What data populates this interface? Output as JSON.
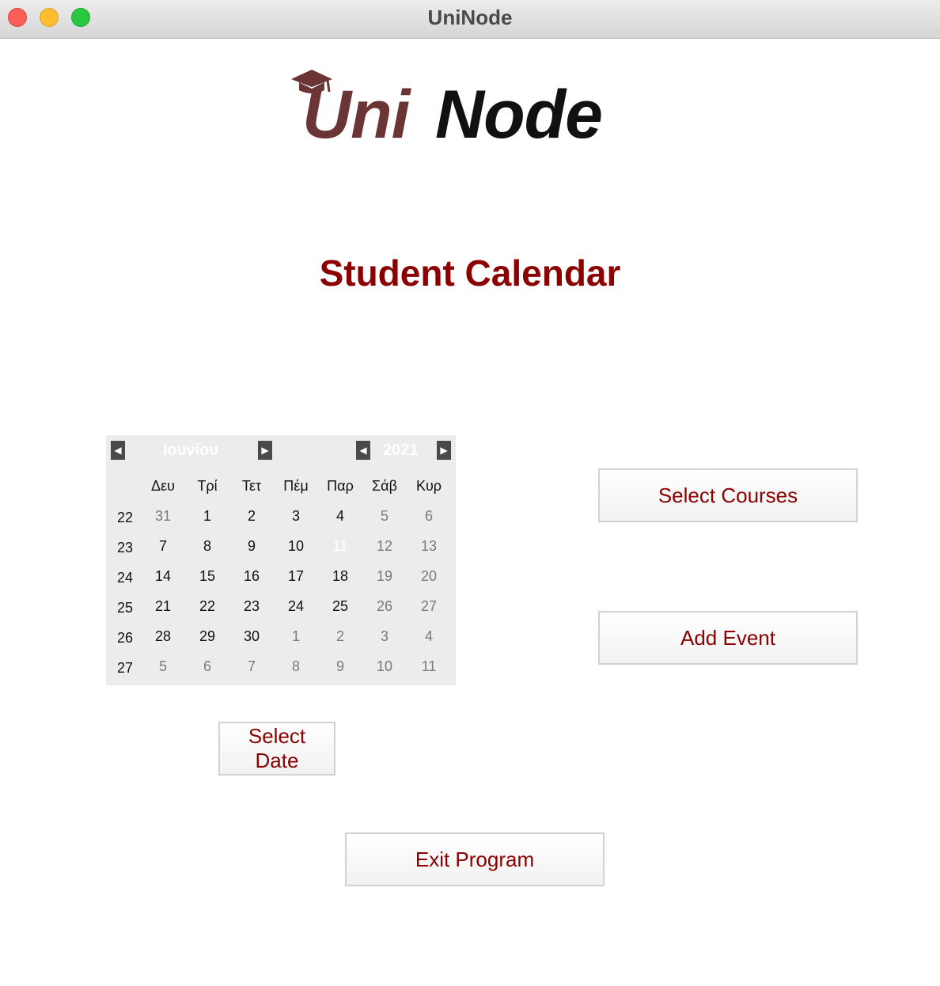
{
  "window": {
    "title": "UniNode"
  },
  "logo": {
    "part1": "Uni",
    "part2": "Node"
  },
  "heading": "Student Calendar",
  "calendar": {
    "month": "Ιουνίου",
    "year": "2021",
    "weekdays": [
      "Δευ",
      "Τρί",
      "Τετ",
      "Πέμ",
      "Παρ",
      "Σάβ",
      "Κυρ"
    ],
    "weeks": [
      {
        "num": "22",
        "days": [
          {
            "d": "31",
            "s": "other"
          },
          {
            "d": "1",
            "s": "in"
          },
          {
            "d": "2",
            "s": "in"
          },
          {
            "d": "3",
            "s": "in"
          },
          {
            "d": "4",
            "s": "in"
          },
          {
            "d": "5",
            "s": "weekend"
          },
          {
            "d": "6",
            "s": "weekend"
          }
        ]
      },
      {
        "num": "23",
        "days": [
          {
            "d": "7",
            "s": "in"
          },
          {
            "d": "8",
            "s": "in"
          },
          {
            "d": "9",
            "s": "in"
          },
          {
            "d": "10",
            "s": "in"
          },
          {
            "d": "11",
            "s": "selected"
          },
          {
            "d": "12",
            "s": "weekend"
          },
          {
            "d": "13",
            "s": "weekend"
          }
        ]
      },
      {
        "num": "24",
        "days": [
          {
            "d": "14",
            "s": "in"
          },
          {
            "d": "15",
            "s": "in"
          },
          {
            "d": "16",
            "s": "in"
          },
          {
            "d": "17",
            "s": "in"
          },
          {
            "d": "18",
            "s": "in"
          },
          {
            "d": "19",
            "s": "weekend"
          },
          {
            "d": "20",
            "s": "weekend"
          }
        ]
      },
      {
        "num": "25",
        "days": [
          {
            "d": "21",
            "s": "in"
          },
          {
            "d": "22",
            "s": "in"
          },
          {
            "d": "23",
            "s": "in"
          },
          {
            "d": "24",
            "s": "in"
          },
          {
            "d": "25",
            "s": "in"
          },
          {
            "d": "26",
            "s": "weekend"
          },
          {
            "d": "27",
            "s": "weekend"
          }
        ]
      },
      {
        "num": "26",
        "days": [
          {
            "d": "28",
            "s": "in"
          },
          {
            "d": "29",
            "s": "in"
          },
          {
            "d": "30",
            "s": "in"
          },
          {
            "d": "1",
            "s": "other"
          },
          {
            "d": "2",
            "s": "other"
          },
          {
            "d": "3",
            "s": "other"
          },
          {
            "d": "4",
            "s": "other"
          }
        ]
      },
      {
        "num": "27",
        "days": [
          {
            "d": "5",
            "s": "other"
          },
          {
            "d": "6",
            "s": "other"
          },
          {
            "d": "7",
            "s": "other"
          },
          {
            "d": "8",
            "s": "other"
          },
          {
            "d": "9",
            "s": "other"
          },
          {
            "d": "10",
            "s": "other"
          },
          {
            "d": "11",
            "s": "other"
          }
        ]
      }
    ]
  },
  "buttons": {
    "select_courses": "Select Courses",
    "add_event": "Add Event",
    "select_date": "Select Date",
    "exit_program": "Exit Program"
  },
  "colors": {
    "accent": "#8b0000",
    "logo_uni": "#6b3535",
    "calendar_bg": "#ececec",
    "day_in": "#111111",
    "day_other": "#7a7a7a",
    "day_selected": "#ffffff"
  }
}
